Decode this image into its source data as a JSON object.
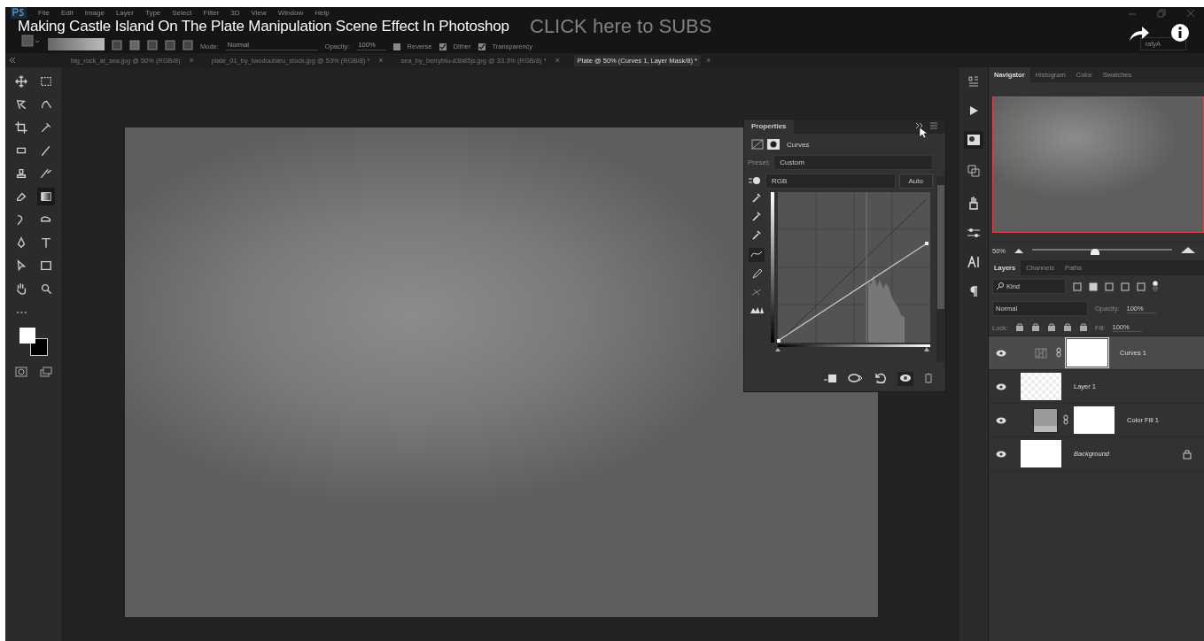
{
  "video_title": "Making Castle Island On The Plate Manipulation Scene Effect In Photoshop",
  "overlay_text": "CLICK here to SUBS",
  "menu": [
    "File",
    "Edit",
    "Image",
    "Layer",
    "Type",
    "Select",
    "Filter",
    "3D",
    "View",
    "Window",
    "Help"
  ],
  "options_bar": {
    "mode_label": "Mode:",
    "mode": "Normal",
    "opacity_label": "Opacity:",
    "opacity": "100%",
    "workspace": "rafyA",
    "checks": [
      {
        "label": "Reverse",
        "checked": false
      },
      {
        "label": "Dither",
        "checked": true
      },
      {
        "label": "Transparency",
        "checked": true
      }
    ]
  },
  "document_tabs": [
    {
      "label": "big_rock_at_sea.jpg @ 50% (RGB/8)",
      "close": "×",
      "selected": false
    },
    {
      "label": "plate_01_by_twodoubleu_stock.jpg @ 53% (RGB/8) *",
      "close": "×",
      "selected": false
    },
    {
      "label": "sea_by_berryblu-d3b85js.jpg @ 33.3% (RGB/8) *",
      "close": "×",
      "selected": false
    },
    {
      "label": "Plate @ 50% (Curves 1, Layer Mask/8) *",
      "close": "×",
      "selected": true
    }
  ],
  "tools": [
    {
      "kind": "move",
      "selected": false
    },
    {
      "kind": "marquee",
      "selected": false
    },
    {
      "kind": "lasso",
      "selected": false
    },
    {
      "kind": "quick-select",
      "selected": false
    },
    {
      "kind": "crop",
      "selected": false
    },
    {
      "kind": "eyedropper",
      "selected": false
    },
    {
      "kind": "healing",
      "selected": false
    },
    {
      "kind": "brush",
      "selected": false
    },
    {
      "kind": "stamp",
      "selected": false
    },
    {
      "kind": "history-brush",
      "selected": false
    },
    {
      "kind": "eraser",
      "selected": false
    },
    {
      "kind": "gradient",
      "selected": true
    },
    {
      "kind": "blur",
      "selected": false
    },
    {
      "kind": "dodge",
      "selected": false
    },
    {
      "kind": "pen",
      "selected": false
    },
    {
      "kind": "type",
      "selected": false
    },
    {
      "kind": "path-select",
      "selected": false
    },
    {
      "kind": "rectangle",
      "selected": false
    },
    {
      "kind": "hand",
      "selected": false
    },
    {
      "kind": "zoom",
      "selected": false
    },
    {
      "kind": "more",
      "selected": false
    }
  ],
  "properties": {
    "title": "Properties",
    "header": "Curves",
    "preset_label": "Preset:",
    "preset": "Custom",
    "channel": "RGB",
    "auto_button": "Auto"
  },
  "navigator": {
    "tabs": [
      {
        "label": "Navigator",
        "selected": true
      },
      {
        "label": "Histogram",
        "selected": false
      },
      {
        "label": "Color",
        "selected": false
      },
      {
        "label": "Swatches",
        "selected": false
      }
    ],
    "zoom": "50%",
    "level": 0.45
  },
  "layers_panel": {
    "tabs": [
      {
        "label": "Layers",
        "selected": true
      },
      {
        "label": "Channels",
        "selected": false
      },
      {
        "label": "Paths",
        "selected": false
      }
    ],
    "filter": "Kind",
    "blend": "Normal",
    "opacity_label": "Opacity:",
    "opacity": "100%",
    "lock_label": "Lock:",
    "fill_label": "Fill:",
    "fill": "100%",
    "layers": [
      {
        "name": "Curves 1",
        "kind": "adjustment",
        "selected": true,
        "locked": false
      },
      {
        "name": "Layer 1",
        "kind": "pixel",
        "selected": false,
        "locked": false
      },
      {
        "name": "Color Fill 1",
        "kind": "fill",
        "selected": false,
        "locked": false
      },
      {
        "name": "Background",
        "kind": "background",
        "selected": false,
        "locked": true
      }
    ]
  }
}
